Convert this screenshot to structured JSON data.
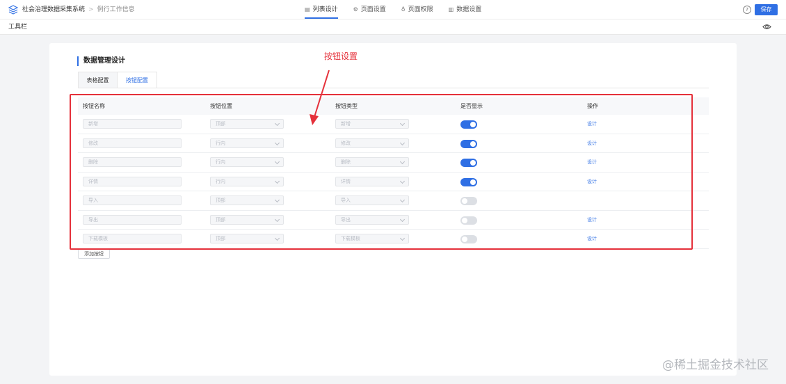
{
  "header": {
    "app_name": "社会治理数据采集系统",
    "breadcrumb_separator": ">",
    "page_name": "例行工作信息",
    "nav_tabs": [
      {
        "label": "列表设计",
        "icon": "list-design-icon",
        "active": true
      },
      {
        "label": "页面设置",
        "icon": "page-settings-icon",
        "active": false
      },
      {
        "label": "页面权限",
        "icon": "permission-icon",
        "active": false
      },
      {
        "label": "数据设置",
        "icon": "bar-chart-icon",
        "active": false
      }
    ],
    "help_glyph": "?",
    "save_label": "保存"
  },
  "toolbar": {
    "label": "工具栏"
  },
  "main": {
    "section_title": "数据管理设计",
    "tabs": [
      {
        "label": "表格配置",
        "active": false
      },
      {
        "label": "按钮配置",
        "active": true
      }
    ],
    "table": {
      "headers": [
        "按钮名称",
        "按钮位置",
        "按钮类型",
        "是否显示",
        "操作"
      ],
      "rows": [
        {
          "name": "新增",
          "position": "顶部",
          "type": "新增",
          "visible": true,
          "action": "设计"
        },
        {
          "name": "修改",
          "position": "行内",
          "type": "修改",
          "visible": true,
          "action": "设计"
        },
        {
          "name": "删除",
          "position": "行内",
          "type": "删除",
          "visible": true,
          "action": "设计"
        },
        {
          "name": "详情",
          "position": "行内",
          "type": "详情",
          "visible": true,
          "action": "设计"
        },
        {
          "name": "导入",
          "position": "顶部",
          "type": "导入",
          "visible": false,
          "action": ""
        },
        {
          "name": "导出",
          "position": "顶部",
          "type": "导出",
          "visible": false,
          "action": "设计"
        },
        {
          "name": "下载模板",
          "position": "顶部",
          "type": "下载模板",
          "visible": false,
          "action": "设计"
        }
      ]
    },
    "add_button_label": "添加按钮"
  },
  "annotation": {
    "label": "按钮设置"
  },
  "watermark": "@稀土掘金技术社区",
  "colors": {
    "accent": "#2f6fe4",
    "annotation": "#e5303a"
  }
}
